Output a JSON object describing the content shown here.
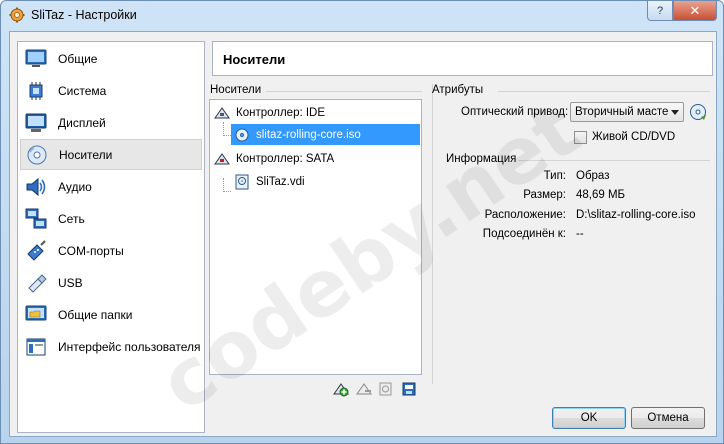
{
  "window": {
    "title": "SliTaz - Настройки",
    "help_label": "?",
    "close_label": "✕"
  },
  "sidebar": {
    "items": [
      {
        "label": "Общие",
        "icon": "monitor-general-icon"
      },
      {
        "label": "Система",
        "icon": "chip-icon"
      },
      {
        "label": "Дисплей",
        "icon": "display-icon"
      },
      {
        "label": "Носители",
        "icon": "storage-disk-icon"
      },
      {
        "label": "Аудио",
        "icon": "speaker-icon"
      },
      {
        "label": "Сеть",
        "icon": "network-icon"
      },
      {
        "label": "COM-порты",
        "icon": "serial-port-icon"
      },
      {
        "label": "USB",
        "icon": "usb-icon"
      },
      {
        "label": "Общие папки",
        "icon": "shared-folder-icon"
      },
      {
        "label": "Интерфейс пользователя",
        "icon": "user-interface-icon"
      }
    ],
    "selected_index": 3
  },
  "header": {
    "title": "Носители"
  },
  "storage": {
    "section_label": "Носители",
    "tree": {
      "controllers": [
        {
          "label": "Контроллер: IDE",
          "children": [
            {
              "label": "slitaz-rolling-core.iso",
              "type": "optical"
            }
          ]
        },
        {
          "label": "Контроллер: SATA",
          "children": [
            {
              "label": "SliTaz.vdi",
              "type": "disk"
            }
          ]
        }
      ],
      "selected": "slitaz-rolling-core.iso"
    }
  },
  "attributes": {
    "section_label": "Атрибуты",
    "optical_drive_label": "Оптический привод:",
    "optical_drive_value": "Вторичный масте",
    "live_cd_label": "Живой CD/DVD",
    "live_cd_checked": false
  },
  "information": {
    "section_label": "Информация",
    "rows": [
      {
        "key": "Тип:",
        "value": "Образ"
      },
      {
        "key": "Размер:",
        "value": "48,69 МБ"
      },
      {
        "key": "Расположение:",
        "value": "D:\\slitaz-rolling-core.iso"
      },
      {
        "key": "Подсоединён к:",
        "value": "--"
      }
    ]
  },
  "buttons": {
    "ok": "OK",
    "cancel": "Отмена"
  },
  "watermark": "codeby.net"
}
